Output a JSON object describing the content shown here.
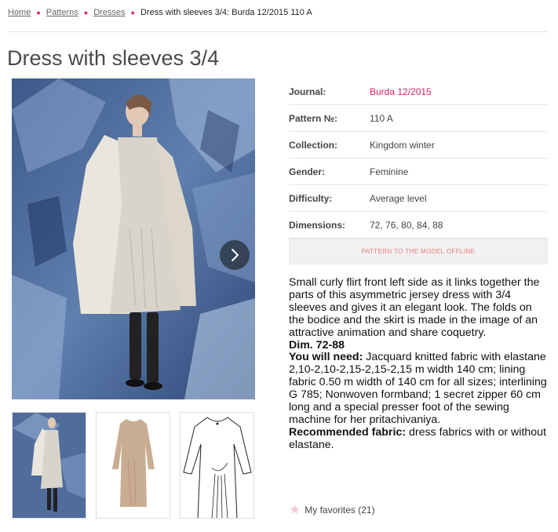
{
  "breadcrumb": {
    "items": [
      "Home",
      "Patterns",
      "Dresses"
    ],
    "current": "Dress with sleeves 3/4: Burda 12/2015 110 A"
  },
  "page_title": "Dress with sleeves 3/4",
  "details": {
    "rows": [
      {
        "label": "Journal:",
        "value": "Burda 12/2015",
        "is_link": true
      },
      {
        "label": "Pattern №:",
        "value": "110 A",
        "is_link": false
      },
      {
        "label": "Collection:",
        "value": "Kingdom winter",
        "is_link": false
      },
      {
        "label": "Gender:",
        "value": "Feminine",
        "is_link": false
      },
      {
        "label": "Difficulty:",
        "value": "Average level",
        "is_link": false
      },
      {
        "label": "Dimensions:",
        "value": "72, 76, 80, 84, 88",
        "is_link": false
      }
    ],
    "offline_button": "PATTERN TO THE MODEL OFFLINE"
  },
  "description": {
    "text": "Small curly flirt front left side as it links together the parts of this asymmetric jersey dress with 3/4 sleeves and gives it an elegant look. The folds on the bodice and the skirt is made in the image of an attractive animation and share coquetry.",
    "dim": "Dim. 72-88",
    "need_label": "You will need:",
    "need_text": " Jacquard knitted fabric with elastane 2,10-2,10-2,15-2,15-2,15 m width 140 cm; lining fabric 0.50 m width of 140 cm for all sizes; interlining G 785; Nonwoven formband; 1 secret zipper 60 cm long and a special presser foot of the sewing machine for her pritachivaniya.",
    "fabric_label": "Recommended fabric:",
    "fabric_text": " dress fabrics with or without elastane."
  },
  "favorites": {
    "label": "My favorites (21)"
  },
  "icons": {
    "next": "chevron-right-icon",
    "star": "star-icon"
  },
  "colors": {
    "accent": "#e0245e",
    "title": "#4a4a4a",
    "button_bg": "#f1f1f1",
    "button_text": "#e97a7a"
  }
}
